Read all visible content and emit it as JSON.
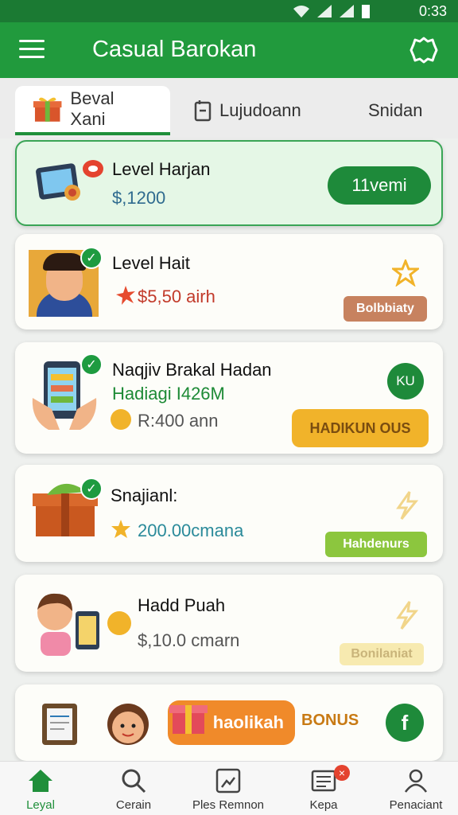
{
  "status": {
    "time": "0:33"
  },
  "appbar": {
    "title": "Casual Barokan"
  },
  "tabs": [
    {
      "label": "Beval Xani"
    },
    {
      "label": "Lujudoann"
    },
    {
      "label": "Snidan"
    }
  ],
  "cards": [
    {
      "title": "Level Harjan",
      "value": "$,1200",
      "action": "11vemi"
    },
    {
      "title": "Level Hait",
      "value": "$5,50 airh",
      "badge": "Bolbbiaty"
    },
    {
      "title": "Naqjiv Brakal Hadan",
      "subtitle": "Hadiagi I426M",
      "value": "R:400 ann",
      "status": "KU",
      "badge": "HADIKUN OUS"
    },
    {
      "title": "Snajianl:",
      "value": "200.00cmana",
      "badge": "Hahdenurs"
    },
    {
      "title": "Hadd Puah",
      "value": "$,10.0 cmarn",
      "badge": "Bonilaniat"
    },
    {
      "banner": "haolikah",
      "badge": "BONUS",
      "status": "f"
    }
  ],
  "bottomnav": [
    {
      "label": "Leyal"
    },
    {
      "label": "Cerain"
    },
    {
      "label": "Ples Remnon"
    },
    {
      "label": "Kepa",
      "notif": "×"
    },
    {
      "label": "Penaciant"
    }
  ],
  "colors": {
    "primary": "#219a3d",
    "accent": "#f1b32a",
    "highlight": "#e5f7e6"
  }
}
